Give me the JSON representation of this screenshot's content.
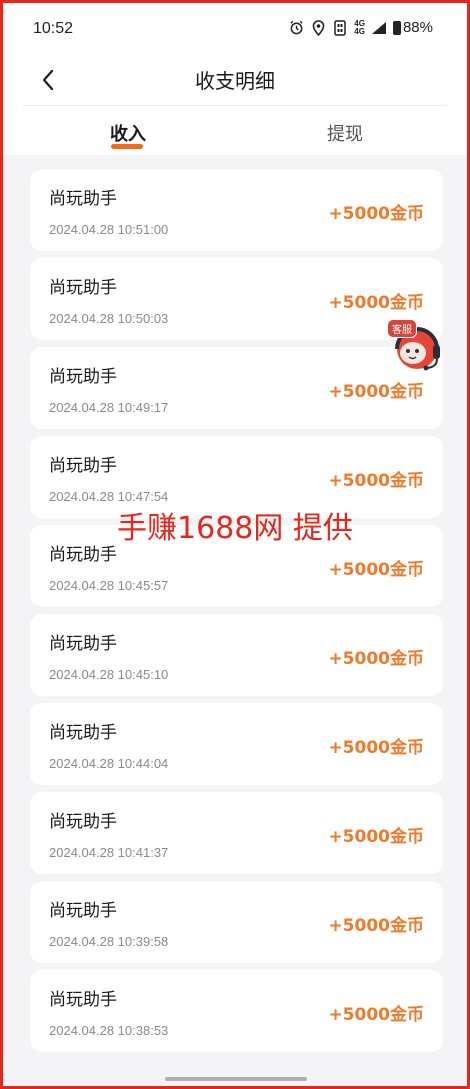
{
  "status_bar": {
    "time": "10:52",
    "network_top": "4G",
    "network_bottom": "4G",
    "battery": "88%"
  },
  "header": {
    "title": "收支明细"
  },
  "tabs": [
    {
      "label": "收入",
      "active": true
    },
    {
      "label": "提现",
      "active": false
    }
  ],
  "records": [
    {
      "title": "尚玩助手",
      "time": "2024.04.28 10:51:00",
      "amount": "+5000金币"
    },
    {
      "title": "尚玩助手",
      "time": "2024.04.28 10:50:03",
      "amount": "+5000金币"
    },
    {
      "title": "尚玩助手",
      "time": "2024.04.28 10:49:17",
      "amount": "+5000金币"
    },
    {
      "title": "尚玩助手",
      "time": "2024.04.28 10:47:54",
      "amount": "+5000金币"
    },
    {
      "title": "尚玩助手",
      "time": "2024.04.28 10:45:57",
      "amount": "+5000金币"
    },
    {
      "title": "尚玩助手",
      "time": "2024.04.28 10:45:10",
      "amount": "+5000金币"
    },
    {
      "title": "尚玩助手",
      "time": "2024.04.28 10:44:04",
      "amount": "+5000金币"
    },
    {
      "title": "尚玩助手",
      "time": "2024.04.28 10:41:37",
      "amount": "+5000金币"
    },
    {
      "title": "尚玩助手",
      "time": "2024.04.28 10:39:58",
      "amount": "+5000金币"
    },
    {
      "title": "尚玩助手",
      "time": "2024.04.28 10:38:53",
      "amount": "+5000金币"
    }
  ],
  "customer_service": {
    "badge": "客服"
  },
  "watermark": "手赚1688网 提供",
  "colors": {
    "accent": "#f26a1b",
    "amount": "#f07a2a",
    "frame_border": "#e8261c",
    "background": "#f4f4f6"
  }
}
